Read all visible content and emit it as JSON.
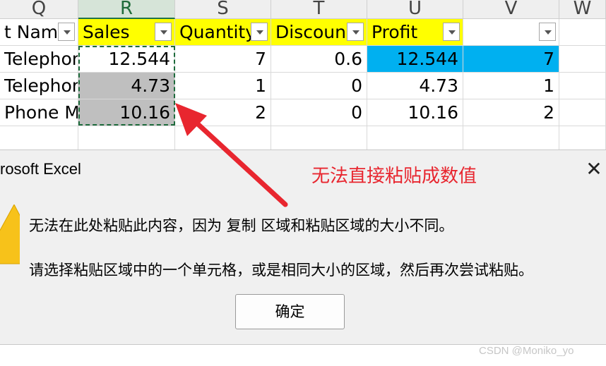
{
  "spreadsheet": {
    "column_headers": [
      "Q",
      "R",
      "S",
      "T",
      "U",
      "V",
      "W"
    ],
    "header_row": {
      "q": "t Name",
      "r": "Sales",
      "s": "Quantity",
      "t": "Discoun",
      "u": "Profit",
      "v": ""
    },
    "rows": [
      {
        "q": "Telephones",
        "r": "12.544",
        "s": "7",
        "t": "0.6",
        "u": "12.544",
        "v": "7"
      },
      {
        "q": "Telephones",
        "r": "4.73",
        "s": "1",
        "t": "0",
        "u": "4.73",
        "v": "1"
      },
      {
        "q": "Phone M",
        "r": "10.16",
        "s": "2",
        "t": "0",
        "u": "10.16",
        "v": "2"
      }
    ],
    "colors": {
      "header_fill": "#ffff00",
      "highlight_fill": "#00b0f0",
      "selected_fill": "#bfbfbf",
      "cut_border": "#1e6b3c"
    }
  },
  "dialog": {
    "title": "rosoft Excel",
    "close_symbol": "✕",
    "message_line1": "无法在此处粘贴此内容，因为 复制 区域和粘贴区域的大小不同。",
    "message_line2": "请选择粘贴区域中的一个单元格，或是相同大小的区域，然后再次尝试粘贴。",
    "ok_label": "确定",
    "icon": "warning-icon"
  },
  "annotation": {
    "text": "无法直接粘贴成数值",
    "color": "#e8262f"
  },
  "watermark": "CSDN @Moniko_yo"
}
